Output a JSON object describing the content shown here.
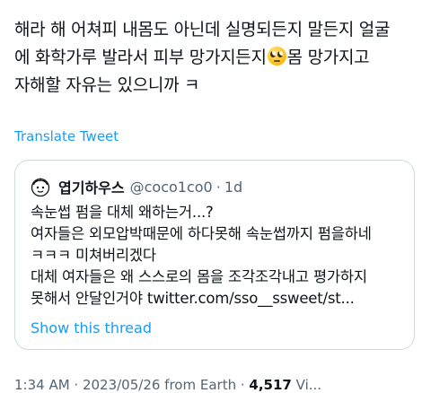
{
  "tweet": {
    "lines": [
      "해라 해 어쳐피 내몸도 아닌데 실명되든지 말든지 얼굴",
      "에 화학가루 발라서 피부 망가지든지",
      "몸 망가지고",
      "자해할 자유는 있으니까 ㅋ"
    ],
    "emoji": "face-with-rolling-eyes"
  },
  "translate_label": "Translate Tweet",
  "quote": {
    "display_name": "엽기하우스",
    "handle": "@coco1co0",
    "separator": "·",
    "time": "1d",
    "lines": [
      "속눈썹 펌을 대체 왜하는거...?",
      "여자들은 외모압박때문에 하다못해 속눈썹까지 펌을하네",
      "ㅋㅋㅋ 미쳐버리겠다",
      "대체 여자들은 왜 스스로의 몸을 조각조각내고 평가하지",
      "못해서 안달인거야 twitter.com/sso__ssweet/st..."
    ],
    "show_thread_label": "Show this thread"
  },
  "meta": {
    "timestamp": "1:34 AM · 2023/05/26 from Earth ·",
    "views": "4,517",
    "views_label": "Vi..."
  }
}
